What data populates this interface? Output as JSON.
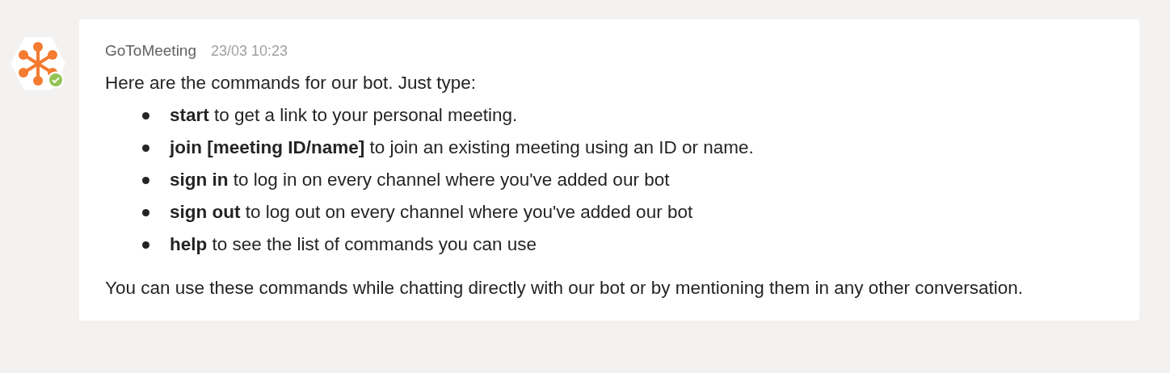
{
  "message": {
    "author": "GoToMeeting",
    "timestamp": "23/03 10:23",
    "online": true,
    "intro": "Here are the commands for our bot. Just type:",
    "commands": [
      "**start** to get a link to your personal meeting.",
      "**join [meeting ID/name]** to join an existing meeting using an ID or name.",
      "**sign in** to log in on every channel where you've added our bot",
      "**sign out** to log out on every channel where you've added our bot",
      "**help** to see the list of commands you can use"
    ],
    "footer": "You can use these commands while chatting directly with our bot or by mentioning them in any other conversation."
  }
}
